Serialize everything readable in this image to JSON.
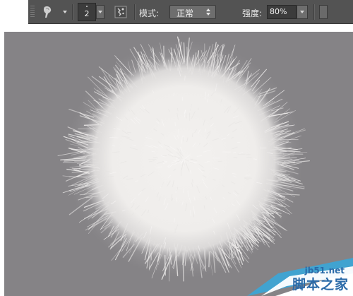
{
  "toolbar": {
    "brush_size": "2",
    "mode_label": "模式:",
    "mode_value": "正常",
    "strength_label": "强度:",
    "strength_value": "80%",
    "icons": {
      "tool": "smudge-finger-icon",
      "panel": "brush-panel-icon"
    }
  },
  "canvas": {
    "background": "#858386",
    "fur_ball_color": "#f2f0ee"
  },
  "watermark": {
    "url": "jb51.net",
    "site": "脚本之家",
    "color": "#2a6aa8"
  }
}
